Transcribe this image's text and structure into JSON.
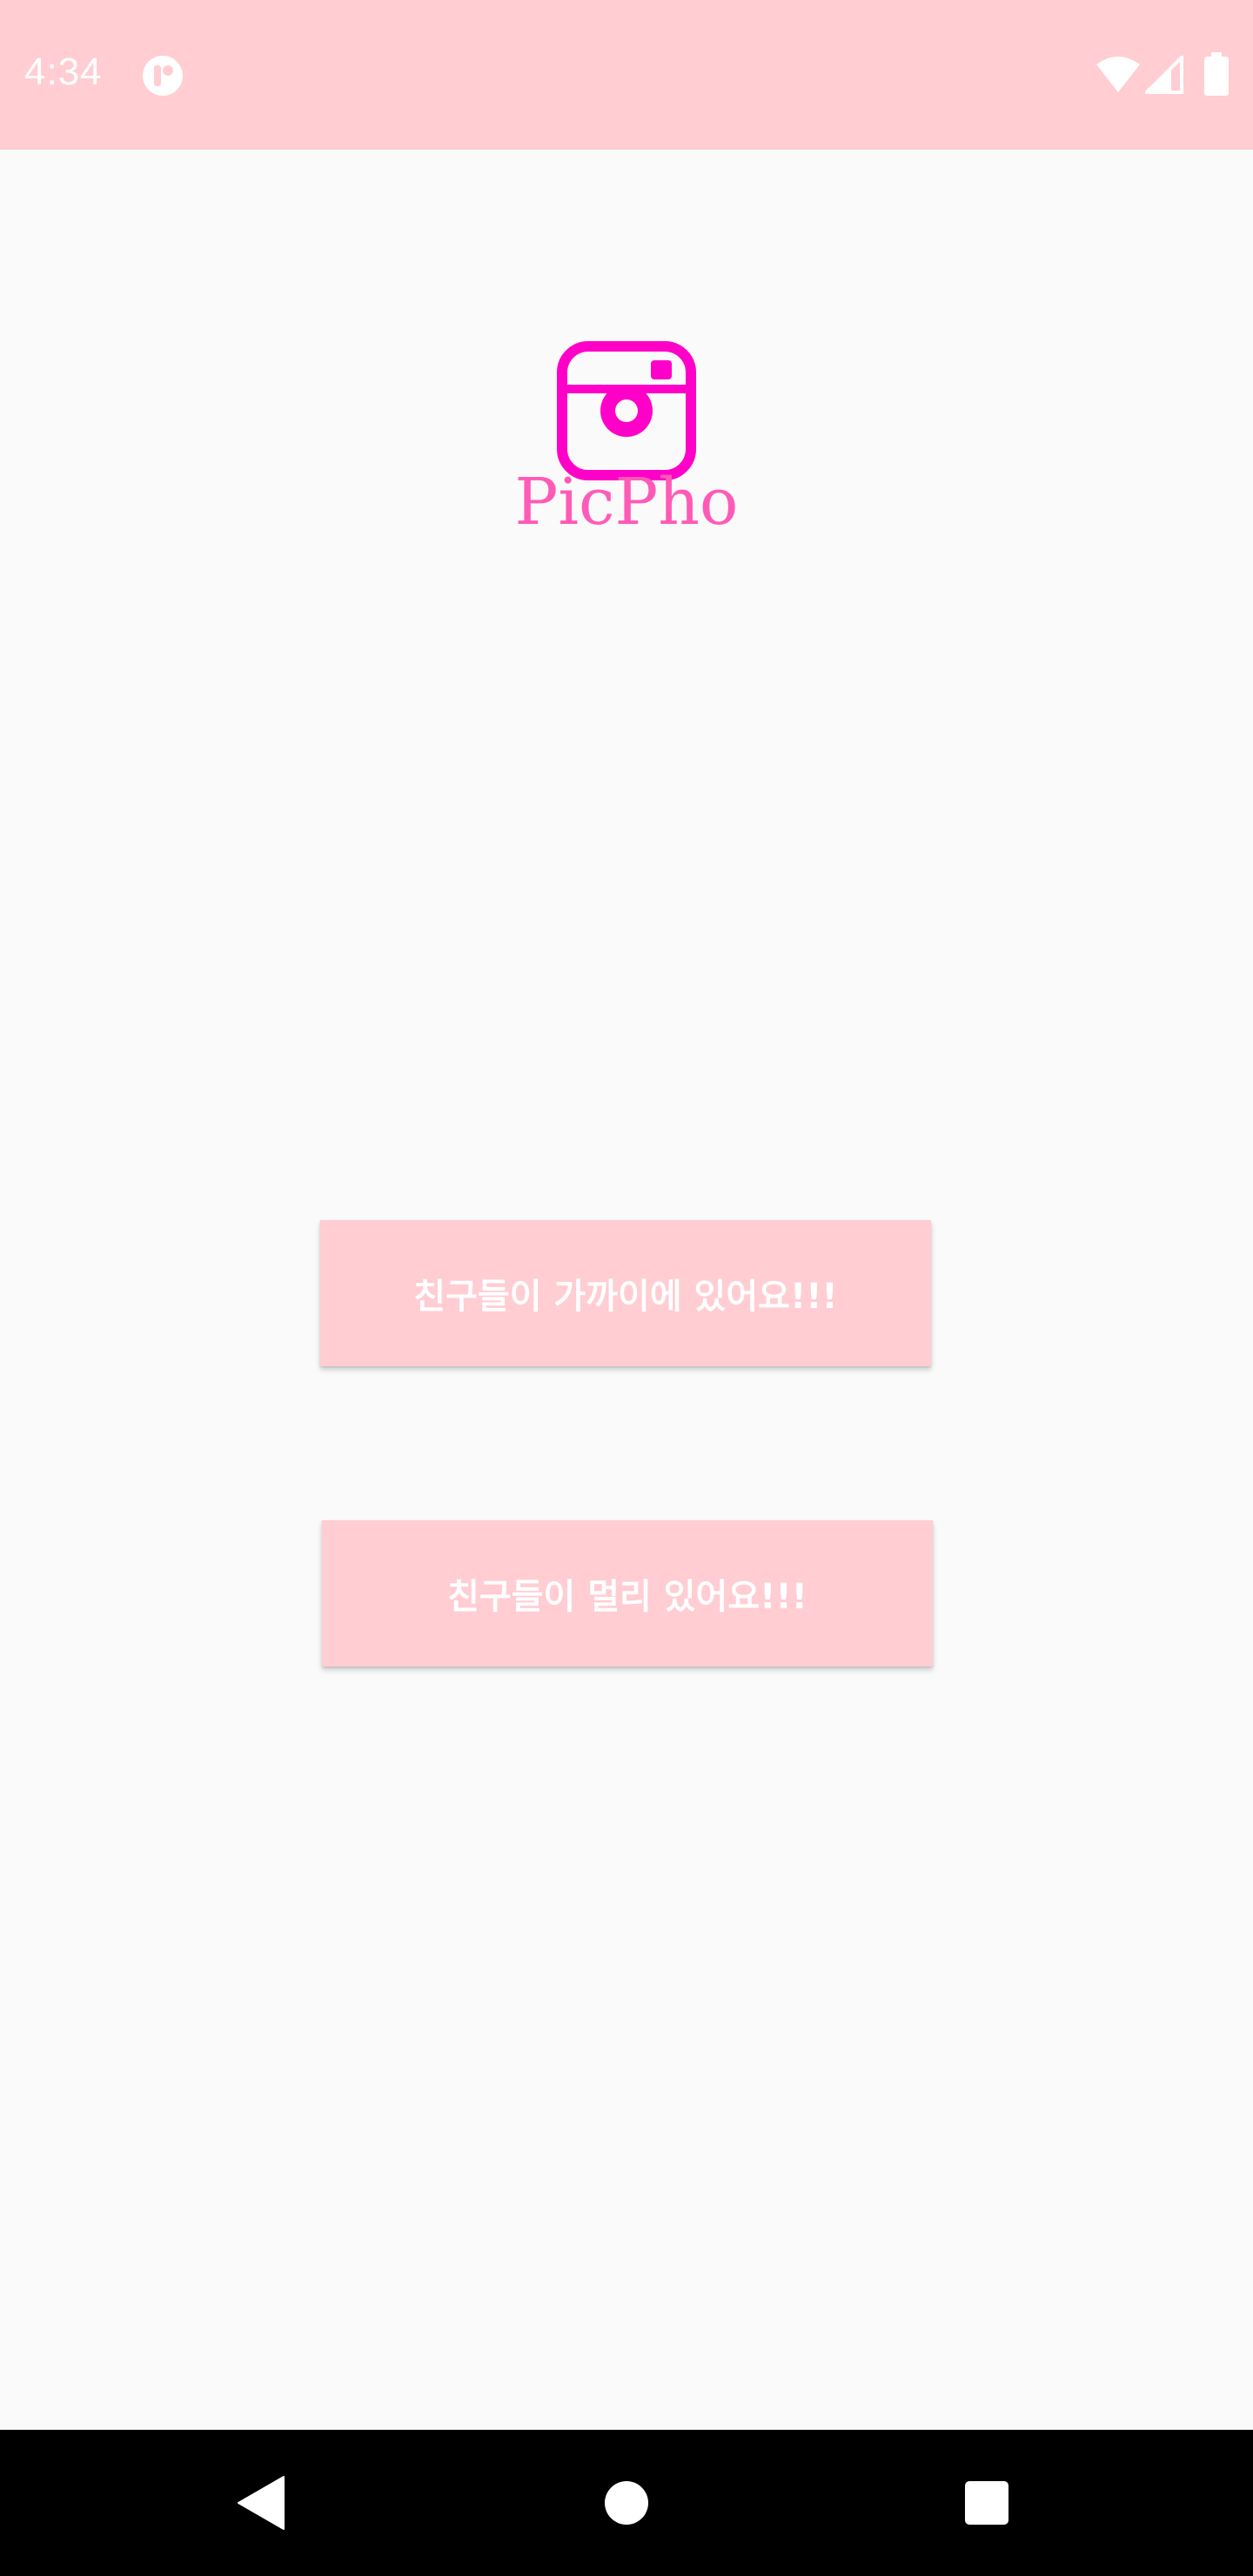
{
  "status_bar": {
    "time": "4:34",
    "icons": [
      "notification-app-icon",
      "wifi-icon",
      "cell-signal-icon",
      "battery-icon"
    ],
    "background": "#ffcdd2"
  },
  "logo": {
    "icon": "camera-icon",
    "text": "PicPho",
    "icon_color": "#ff00c8",
    "text_color": "#ff5ab7"
  },
  "buttons": {
    "friends_near_label": "친구들이 가까이에 있어요!!!",
    "friends_far_label": "친구들이 멀리 있어요!!!",
    "background": "#ffcdd2",
    "text_color": "#ffffff"
  },
  "nav_bar": {
    "icons": [
      "back-icon",
      "home-icon",
      "recents-icon"
    ]
  }
}
